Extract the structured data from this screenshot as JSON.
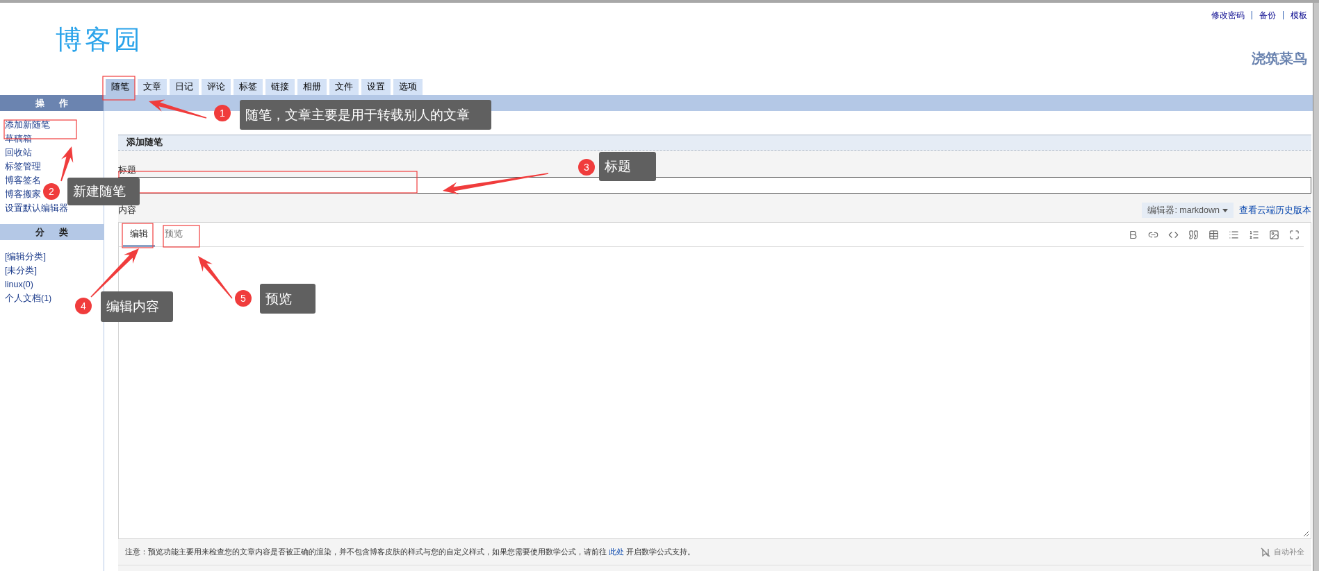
{
  "header": {
    "logo": "博客园",
    "links": [
      {
        "kind": "link",
        "text": "修改密码"
      },
      {
        "kind": "separator",
        "text": "|"
      },
      {
        "kind": "link",
        "text": "备份"
      },
      {
        "kind": "separator",
        "text": "|"
      },
      {
        "kind": "link",
        "text": "模板"
      }
    ],
    "blog_name": "浇筑菜鸟"
  },
  "tabs": [
    {
      "label": "随笔",
      "selected": true
    },
    {
      "label": "文章",
      "selected": false
    },
    {
      "label": "日记",
      "selected": false
    },
    {
      "label": "评论",
      "selected": false
    },
    {
      "label": "标签",
      "selected": false
    },
    {
      "label": "链接",
      "selected": false
    },
    {
      "label": "相册",
      "selected": false
    },
    {
      "label": "文件",
      "selected": false
    },
    {
      "label": "设置",
      "selected": false
    },
    {
      "label": "选项",
      "selected": false
    }
  ],
  "sidebar": {
    "sections": [
      {
        "title": "操 作",
        "active": true,
        "items": [
          "添加新随笔",
          "草稿箱",
          "回收站",
          "标签管理",
          "博客签名",
          "博客搬家",
          "设置默认编辑器"
        ]
      },
      {
        "title": "分 类",
        "active": false,
        "items": [
          "[编辑分类]",
          "[未分类]",
          "linux(0)",
          "个人文档(1)"
        ]
      }
    ]
  },
  "editor_page": {
    "heading": "添加随笔",
    "title_label": "标题",
    "content_label": "内容",
    "editor_select": "编辑器: markdown",
    "history_link": "查看云端历史版本",
    "editor_tabs": [
      {
        "label": "编辑",
        "selected": true
      },
      {
        "label": "预览",
        "selected": false
      }
    ],
    "notice_before": "注意：预览功能主要用来检查您的文章内容是否被正确的渲染，并不包含博客皮肤的样式与您的自定义样式，如果您需要使用数学公式，请前往",
    "notice_link": "此处",
    "notice_after": "开启数学公式支持。",
    "autocomplete": "自动补全"
  },
  "annotations": [
    {
      "number": "1",
      "text": "随笔，文章主要是用于转载别人的文章"
    },
    {
      "number": "2",
      "text": "新建随笔"
    },
    {
      "number": "3",
      "text": "标题"
    },
    {
      "number": "4",
      "text": "编辑内容"
    },
    {
      "number": "5",
      "text": "预览"
    }
  ]
}
